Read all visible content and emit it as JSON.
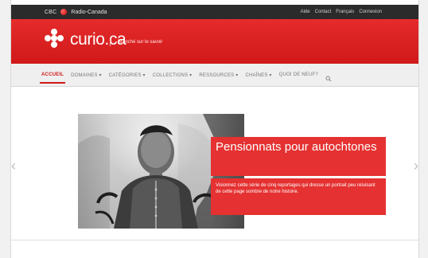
{
  "top_bar": {
    "left_brand": "CBC",
    "source": "Radio-Canada",
    "right_links": [
      "Aide",
      "Contact",
      "Français",
      "Connexion"
    ]
  },
  "header": {
    "logo_text": "curio.ca",
    "tagline": "Branché sur le savoir"
  },
  "nav": {
    "items": [
      {
        "label": "ACCUEIL",
        "active": true
      },
      {
        "label": "DOMAINES ▾",
        "active": false
      },
      {
        "label": "CATÉGORIES ▾",
        "active": false
      },
      {
        "label": "COLLECTIONS ▾",
        "active": false
      },
      {
        "label": "RESSOURCES ▾",
        "active": false
      },
      {
        "label": "CHAÎNES ▾",
        "active": false
      },
      {
        "label": "QUOI DE NEUF?",
        "active": false
      }
    ]
  },
  "hero": {
    "title": "Pensionnats pour autochtones",
    "description": "Visionnez cette série de cinq reportages qui dresse un portrait peu reluisant de cette page sombre de notre histoire."
  },
  "colors": {
    "brand_red": "#d11919",
    "nav_gray": "#efefef",
    "dark_strip": "#2b2b2b",
    "hero_red": "#e53131"
  }
}
